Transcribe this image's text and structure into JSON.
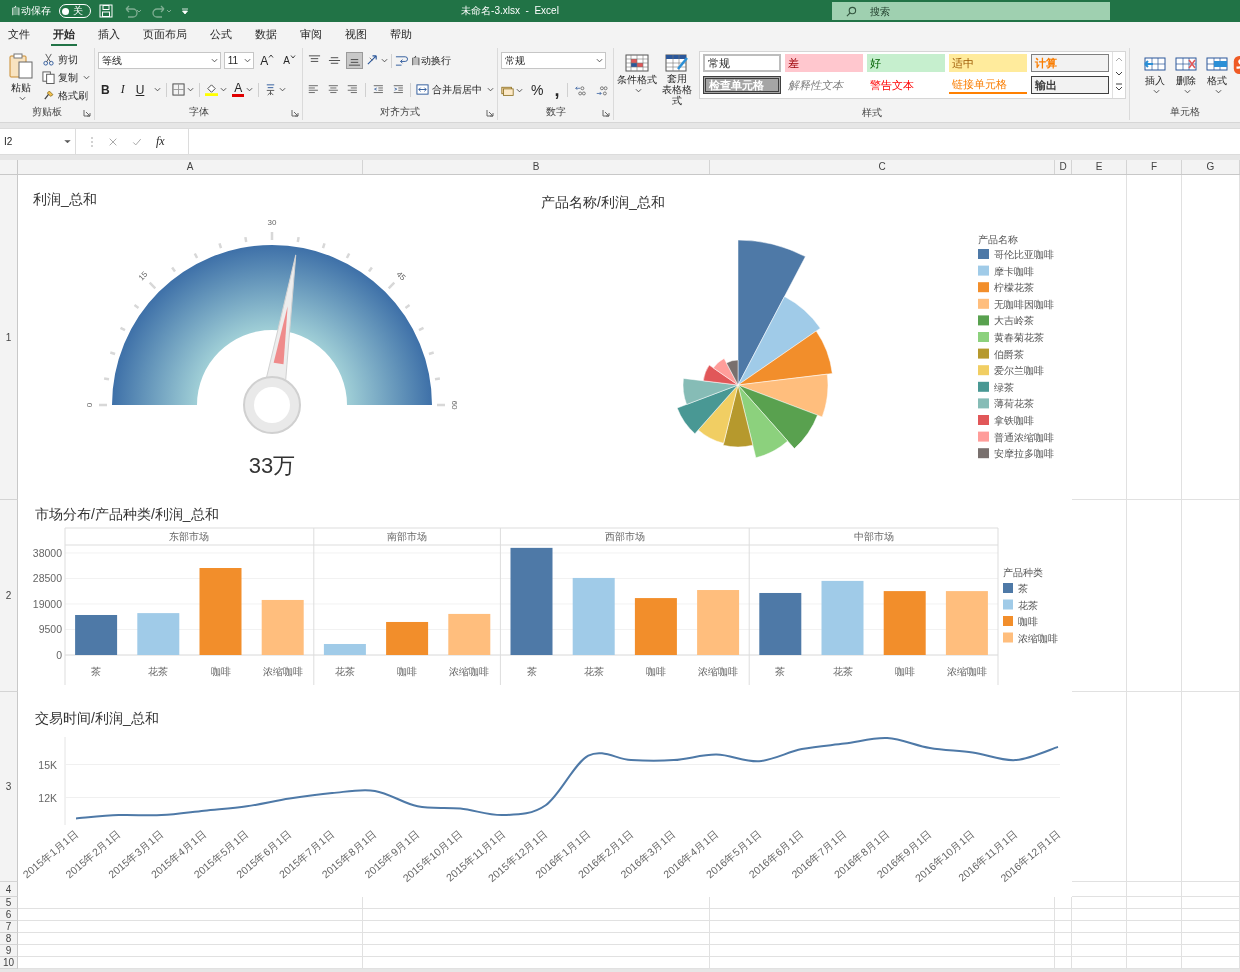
{
  "titlebar": {
    "autosave_label": "自动保存",
    "autosave": {
      "on": false,
      "label": "关"
    },
    "title": "未命名-3.xlsx  -  Excel",
    "search": {
      "placeholder": "搜索"
    }
  },
  "tabs": [
    {
      "label": "文件",
      "selected": false
    },
    {
      "label": "开始",
      "selected": true
    },
    {
      "label": "插入",
      "selected": false
    },
    {
      "label": "页面布局",
      "selected": false
    },
    {
      "label": "公式",
      "selected": false
    },
    {
      "label": "数据",
      "selected": false
    },
    {
      "label": "审阅",
      "selected": false
    },
    {
      "label": "视图",
      "selected": false
    },
    {
      "label": "帮助",
      "selected": false
    }
  ],
  "ribbon": {
    "clipboard": {
      "paste": "粘贴",
      "cut": "剪切",
      "copy": "复制",
      "painter": "格式刷",
      "label": "剪贴板"
    },
    "font": {
      "family": "等线",
      "size": "11",
      "grow": "A",
      "shrink": "A",
      "styles": [
        {
          "kind": "bold",
          "label": "B"
        },
        {
          "kind": "italic",
          "label": "I"
        },
        {
          "kind": "underline",
          "label": "U"
        }
      ],
      "color_letter": "A",
      "label": "字体"
    },
    "alignment": {
      "vertical": [
        {
          "kind": "top",
          "selected": false
        },
        {
          "kind": "middle",
          "selected": false
        },
        {
          "kind": "bottom",
          "selected": true
        }
      ],
      "wrap": "自动换行",
      "merge": "合并后居中",
      "label": "对齐方式"
    },
    "number": {
      "format": "常规",
      "percent": "%",
      "comma": ",",
      "label": "数字"
    },
    "styles": {
      "conditional": "条件格式",
      "table": [
        "套用",
        "表格格式"
      ],
      "gallery": [
        {
          "label": "常规",
          "kind": "normal"
        },
        {
          "label": "差",
          "kind": "bad"
        },
        {
          "label": "好",
          "kind": "good"
        },
        {
          "label": "适中",
          "kind": "neutral"
        },
        {
          "label": "计算",
          "kind": "calc"
        },
        {
          "label": "检查单元格",
          "kind": "check"
        },
        {
          "label": "解释性文本",
          "kind": "explain"
        },
        {
          "label": "警告文本",
          "kind": "warn"
        },
        {
          "label": "链接单元格",
          "kind": "link"
        },
        {
          "label": "输出",
          "kind": "output"
        }
      ],
      "label": "样式"
    },
    "cells": {
      "buttons": [
        {
          "kind": "insert",
          "label": "插入"
        },
        {
          "kind": "delete",
          "label": "删除"
        },
        {
          "kind": "format",
          "label": "格式"
        }
      ],
      "label": "单元格"
    }
  },
  "formula_bar": {
    "name_box": "I2",
    "fx": "fx"
  },
  "columns": [
    "A",
    "B",
    "C",
    "D",
    "E",
    "F",
    "G"
  ],
  "rows": [
    "1",
    "2",
    "3",
    "4",
    "5",
    "6",
    "7",
    "8",
    "9",
    "10"
  ],
  "dashboard": {
    "gauge": {
      "title": "利润_总和",
      "ticks": [
        "0",
        "15",
        "30",
        "45",
        "60"
      ],
      "level": 0.55,
      "value": "33万"
    },
    "rose": {
      "title": "产品名称/利润_总和",
      "legend_title": "产品名称",
      "items": [
        {
          "name": "哥伦比亚咖啡",
          "color": "#4e79a7"
        },
        {
          "name": "摩卡咖啡",
          "color": "#a0cbe8"
        },
        {
          "name": "柠檬花茶",
          "color": "#f28e2b"
        },
        {
          "name": "无咖啡因咖啡",
          "color": "#ffbe7d"
        },
        {
          "name": "大吉岭茶",
          "color": "#59a14f"
        },
        {
          "name": "黄春菊花茶",
          "color": "#8cd17d"
        },
        {
          "name": "伯爵茶",
          "color": "#b6992d"
        },
        {
          "name": "爱尔兰咖啡",
          "color": "#f1ce63"
        },
        {
          "name": "绿茶",
          "color": "#499894"
        },
        {
          "name": "薄荷花茶",
          "color": "#86bcb6"
        },
        {
          "name": "拿铁咖啡",
          "color": "#e15759"
        },
        {
          "name": "普通浓缩咖啡",
          "color": "#ff9d9a"
        },
        {
          "name": "安摩拉多咖啡",
          "color": "#79706e"
        }
      ]
    },
    "bars": {
      "chart_data": {
        "type": "bar",
        "title": "市场分布/产品种类/利润_总和",
        "categories": [
          "东部市场",
          "南部市场",
          "西部市场",
          "中部市场"
        ],
        "ylim": [
          0,
          40000
        ],
        "yticks": [
          0,
          9500,
          19000,
          28500,
          38000
        ],
        "grid": true,
        "legend": "right",
        "legend_title": "产品种类",
        "series": [
          {
            "name": "茶",
            "color": "#4e79a7",
            "values": [
              14900,
              null,
              39900,
              23100
            ]
          },
          {
            "name": "花茶",
            "color": "#a0cbe8",
            "values": [
              15600,
              4100,
              28700,
              27600
            ]
          },
          {
            "name": "咖啡",
            "color": "#f28e2b",
            "values": [
              32400,
              12300,
              21200,
              23800
            ]
          },
          {
            "name": "浓缩咖啡",
            "color": "#ffbe7d",
            "values": [
              20500,
              15300,
              24200,
              23800
            ]
          }
        ]
      }
    },
    "line": {
      "chart_data": {
        "type": "line",
        "title": "交易时间/利润_总和",
        "categories": [
          "2015年1月1日",
          "2015年2月1日",
          "2015年3月1日",
          "2015年4月1日",
          "2015年5月1日",
          "2015年6月1日",
          "2015年7月1日",
          "2015年8月1日",
          "2015年9月1日",
          "2015年10月1日",
          "2015年11月1日",
          "2015年12月1日",
          "2016年1月1日",
          "2016年2月1日",
          "2016年3月1日",
          "2016年4月1日",
          "2016年5月1日",
          "2016年6月1日",
          "2016年7月1日",
          "2016年8月1日",
          "2016年9月1日",
          "2016年10月1日",
          "2016年11月1日",
          "2016年12月1日"
        ],
        "ylim": [
          9500,
          17500
        ],
        "grid": true,
        "series": [
          {
            "color": "#4e79a7",
            "values": [
              10100,
              10400,
              10400,
              10800,
              11200,
              11900,
              12400,
              12600,
              11200,
              11000,
              10400,
              11300,
              15800,
              15400,
              15400,
              15900,
              15300,
              16400,
              16900,
              17400,
              16500,
              16100,
              15400,
              16600
            ]
          }
        ],
        "yticks": [
          {
            "value": 12000,
            "label": "12K"
          },
          {
            "value": 15000,
            "label": "15K"
          }
        ]
      }
    }
  }
}
